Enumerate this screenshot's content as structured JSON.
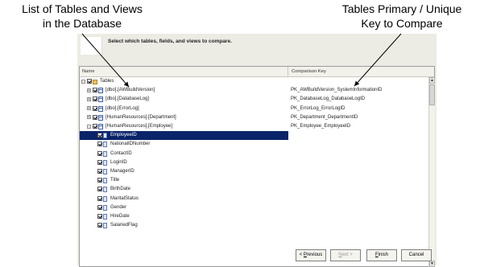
{
  "annotations": {
    "left_line1": "List of Tables and Views",
    "left_line2": "in the Database",
    "right_line1": "Tables Primary / Unique",
    "right_line2": "Key to Compare"
  },
  "wizard": {
    "instruction": "Select which tables, fields, and views to compare.",
    "columns": {
      "name": "Name",
      "key": "Comparison Key"
    },
    "rows": [
      {
        "type": "folder",
        "label": "Tables",
        "key": "",
        "level": 0,
        "expander": "-"
      },
      {
        "type": "table",
        "label": "[dbo].[AWBuildVersion]",
        "key": "PK_AWBuildVersion_SystemInformationID",
        "level": 1,
        "expander": "+"
      },
      {
        "type": "table",
        "label": "[dbo].[DatabaseLog]",
        "key": "PK_DatabaseLog_DatabaseLogID",
        "level": 1,
        "expander": "+"
      },
      {
        "type": "table",
        "label": "[dbo].[ErrorLog]",
        "key": "PK_ErrorLog_ErrorLogID",
        "level": 1,
        "expander": "+"
      },
      {
        "type": "table",
        "label": "[HumanResources].[Department]",
        "key": "PK_Department_DepartmentID",
        "level": 1,
        "expander": "+"
      },
      {
        "type": "table",
        "label": "[HumanResources].[Employee]",
        "key": "PK_Employee_EmployeeID",
        "level": 1,
        "expander": "-"
      },
      {
        "type": "field",
        "label": "EmployeeID",
        "key": "",
        "level": 2,
        "selected": true
      },
      {
        "type": "field",
        "label": "NationalIDNumber",
        "key": "",
        "level": 2
      },
      {
        "type": "field",
        "label": "ContactID",
        "key": "",
        "level": 2
      },
      {
        "type": "field",
        "label": "LoginID",
        "key": "",
        "level": 2
      },
      {
        "type": "field",
        "label": "ManagerID",
        "key": "",
        "level": 2
      },
      {
        "type": "field",
        "label": "Title",
        "key": "",
        "level": 2
      },
      {
        "type": "field",
        "label": "BirthDate",
        "key": "",
        "level": 2
      },
      {
        "type": "field",
        "label": "MaritalStatus",
        "key": "",
        "level": 2
      },
      {
        "type": "field",
        "label": "Gender",
        "key": "",
        "level": 2
      },
      {
        "type": "field",
        "label": "HireDate",
        "key": "",
        "level": 2
      },
      {
        "type": "field",
        "label": "SalariedFlag",
        "key": "",
        "level": 2
      }
    ],
    "buttons": {
      "prev": "< Previous",
      "next": "Next >",
      "finish": "Finish",
      "cancel": "Cancel"
    }
  },
  "icons": {
    "folder": "folder-icon",
    "table": "table-icon",
    "field": "field-icon",
    "scroll_up": "scroll-up-icon",
    "scroll_down": "scroll-down-icon"
  },
  "colors": {
    "selection": "#0a246a",
    "wizard_bg": "#ecebe4"
  }
}
